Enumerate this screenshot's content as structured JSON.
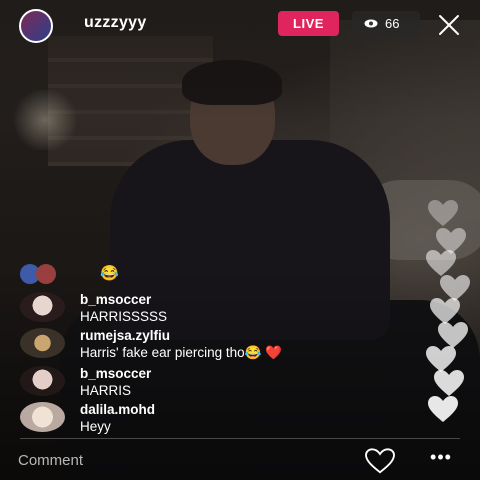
{
  "stream": {
    "host_username": "uzzzyyy",
    "live_label": "LIVE",
    "viewer_count": "66",
    "viewer_icon": "eye-icon",
    "close_icon": "close-icon",
    "colors": {
      "live_badge": "#e0245e",
      "heart": "#e0242c"
    }
  },
  "reaction_row": {
    "emoji": "😂"
  },
  "comments": [
    {
      "username": "b_msoccer",
      "text": "HARRISSSSS"
    },
    {
      "username": "rumejsa.zylfiu",
      "text": "Harris' fake ear piercing tho😂 ❤️"
    },
    {
      "username": "b_msoccer",
      "text": "HARRIS"
    },
    {
      "username": "dalila.mohd",
      "text": "Heyy"
    }
  ],
  "bottom_bar": {
    "comment_placeholder": "Comment",
    "like_icon": "heart-outline-icon",
    "more_icon": "more-dots-icon"
  }
}
